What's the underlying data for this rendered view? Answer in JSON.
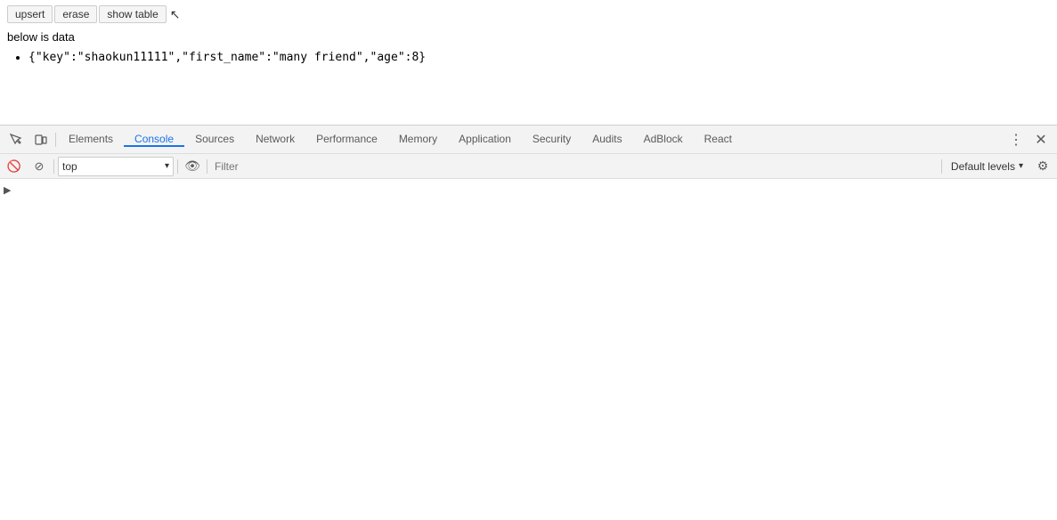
{
  "page": {
    "buttons": [
      {
        "label": "upsert",
        "name": "upsert-button"
      },
      {
        "label": "erase",
        "name": "erase-button"
      },
      {
        "label": "show table",
        "name": "show-table-button"
      }
    ],
    "below_label": "below is data",
    "data_item": "{\"key\":\"shaokun11111\",\"first_name\":\"many friend\",\"age\":8}"
  },
  "devtools": {
    "tabs": [
      {
        "label": "Elements",
        "name": "tab-elements",
        "active": false
      },
      {
        "label": "Console",
        "name": "tab-console",
        "active": true
      },
      {
        "label": "Sources",
        "name": "tab-sources",
        "active": false
      },
      {
        "label": "Network",
        "name": "tab-network",
        "active": false
      },
      {
        "label": "Performance",
        "name": "tab-performance",
        "active": false
      },
      {
        "label": "Memory",
        "name": "tab-memory",
        "active": false
      },
      {
        "label": "Application",
        "name": "tab-application",
        "active": false
      },
      {
        "label": "Security",
        "name": "tab-security",
        "active": false
      },
      {
        "label": "Audits",
        "name": "tab-audits",
        "active": false
      },
      {
        "label": "AdBlock",
        "name": "tab-adblock",
        "active": false
      },
      {
        "label": "React",
        "name": "tab-react",
        "active": false
      }
    ],
    "console_toolbar": {
      "context_label": "top",
      "filter_placeholder": "Filter",
      "default_levels_label": "Default levels"
    }
  }
}
